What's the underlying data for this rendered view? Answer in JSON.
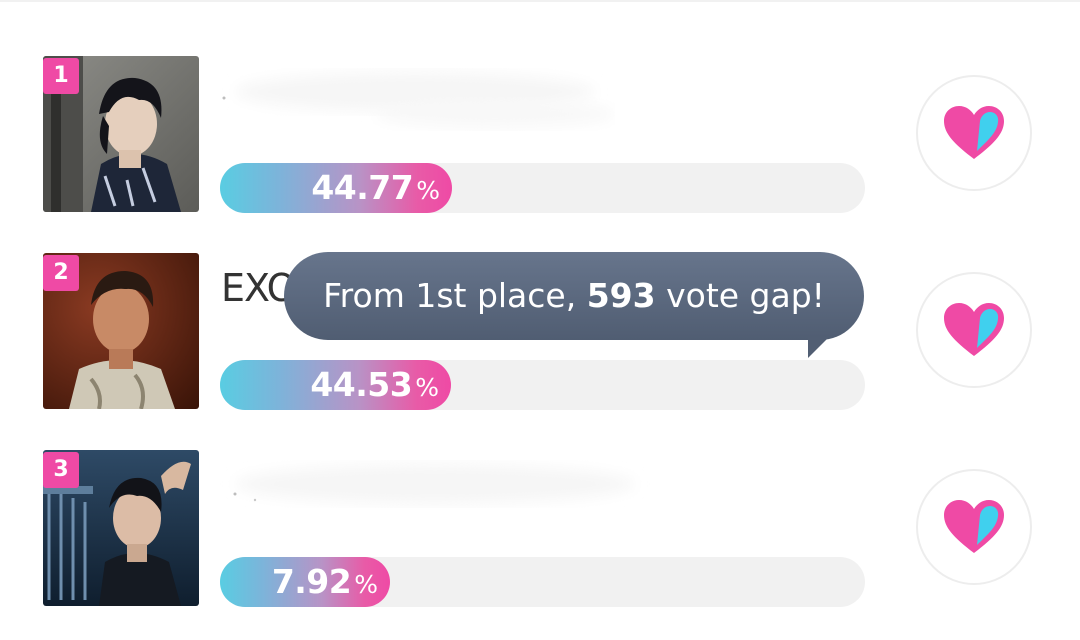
{
  "ranking": {
    "items": [
      {
        "rank": "1",
        "name": "",
        "percent": "44.77",
        "percent_fraction": 0.4477,
        "unit": "%",
        "icon": "heart-icon"
      },
      {
        "rank": "2",
        "name": "EXO",
        "percent": "44.53",
        "percent_fraction": 0.4453,
        "unit": "%",
        "icon": "heart-icon"
      },
      {
        "rank": "3",
        "name": "",
        "percent": "7.92",
        "percent_fraction": 0.0792,
        "unit": "%",
        "icon": "heart-icon"
      }
    ]
  },
  "tooltip": {
    "prefix": "From 1st place, ",
    "gap_number": "593",
    "suffix": " vote gap!"
  },
  "colors": {
    "badge": "#ef4aa5",
    "bar_start": "#59cde2",
    "bar_end": "#ef4aa5",
    "track": "#f1f1f1",
    "tooltip_bg": "#5a677c",
    "heart_pink": "#ef4aa5",
    "heart_cyan": "#40d0ee"
  }
}
